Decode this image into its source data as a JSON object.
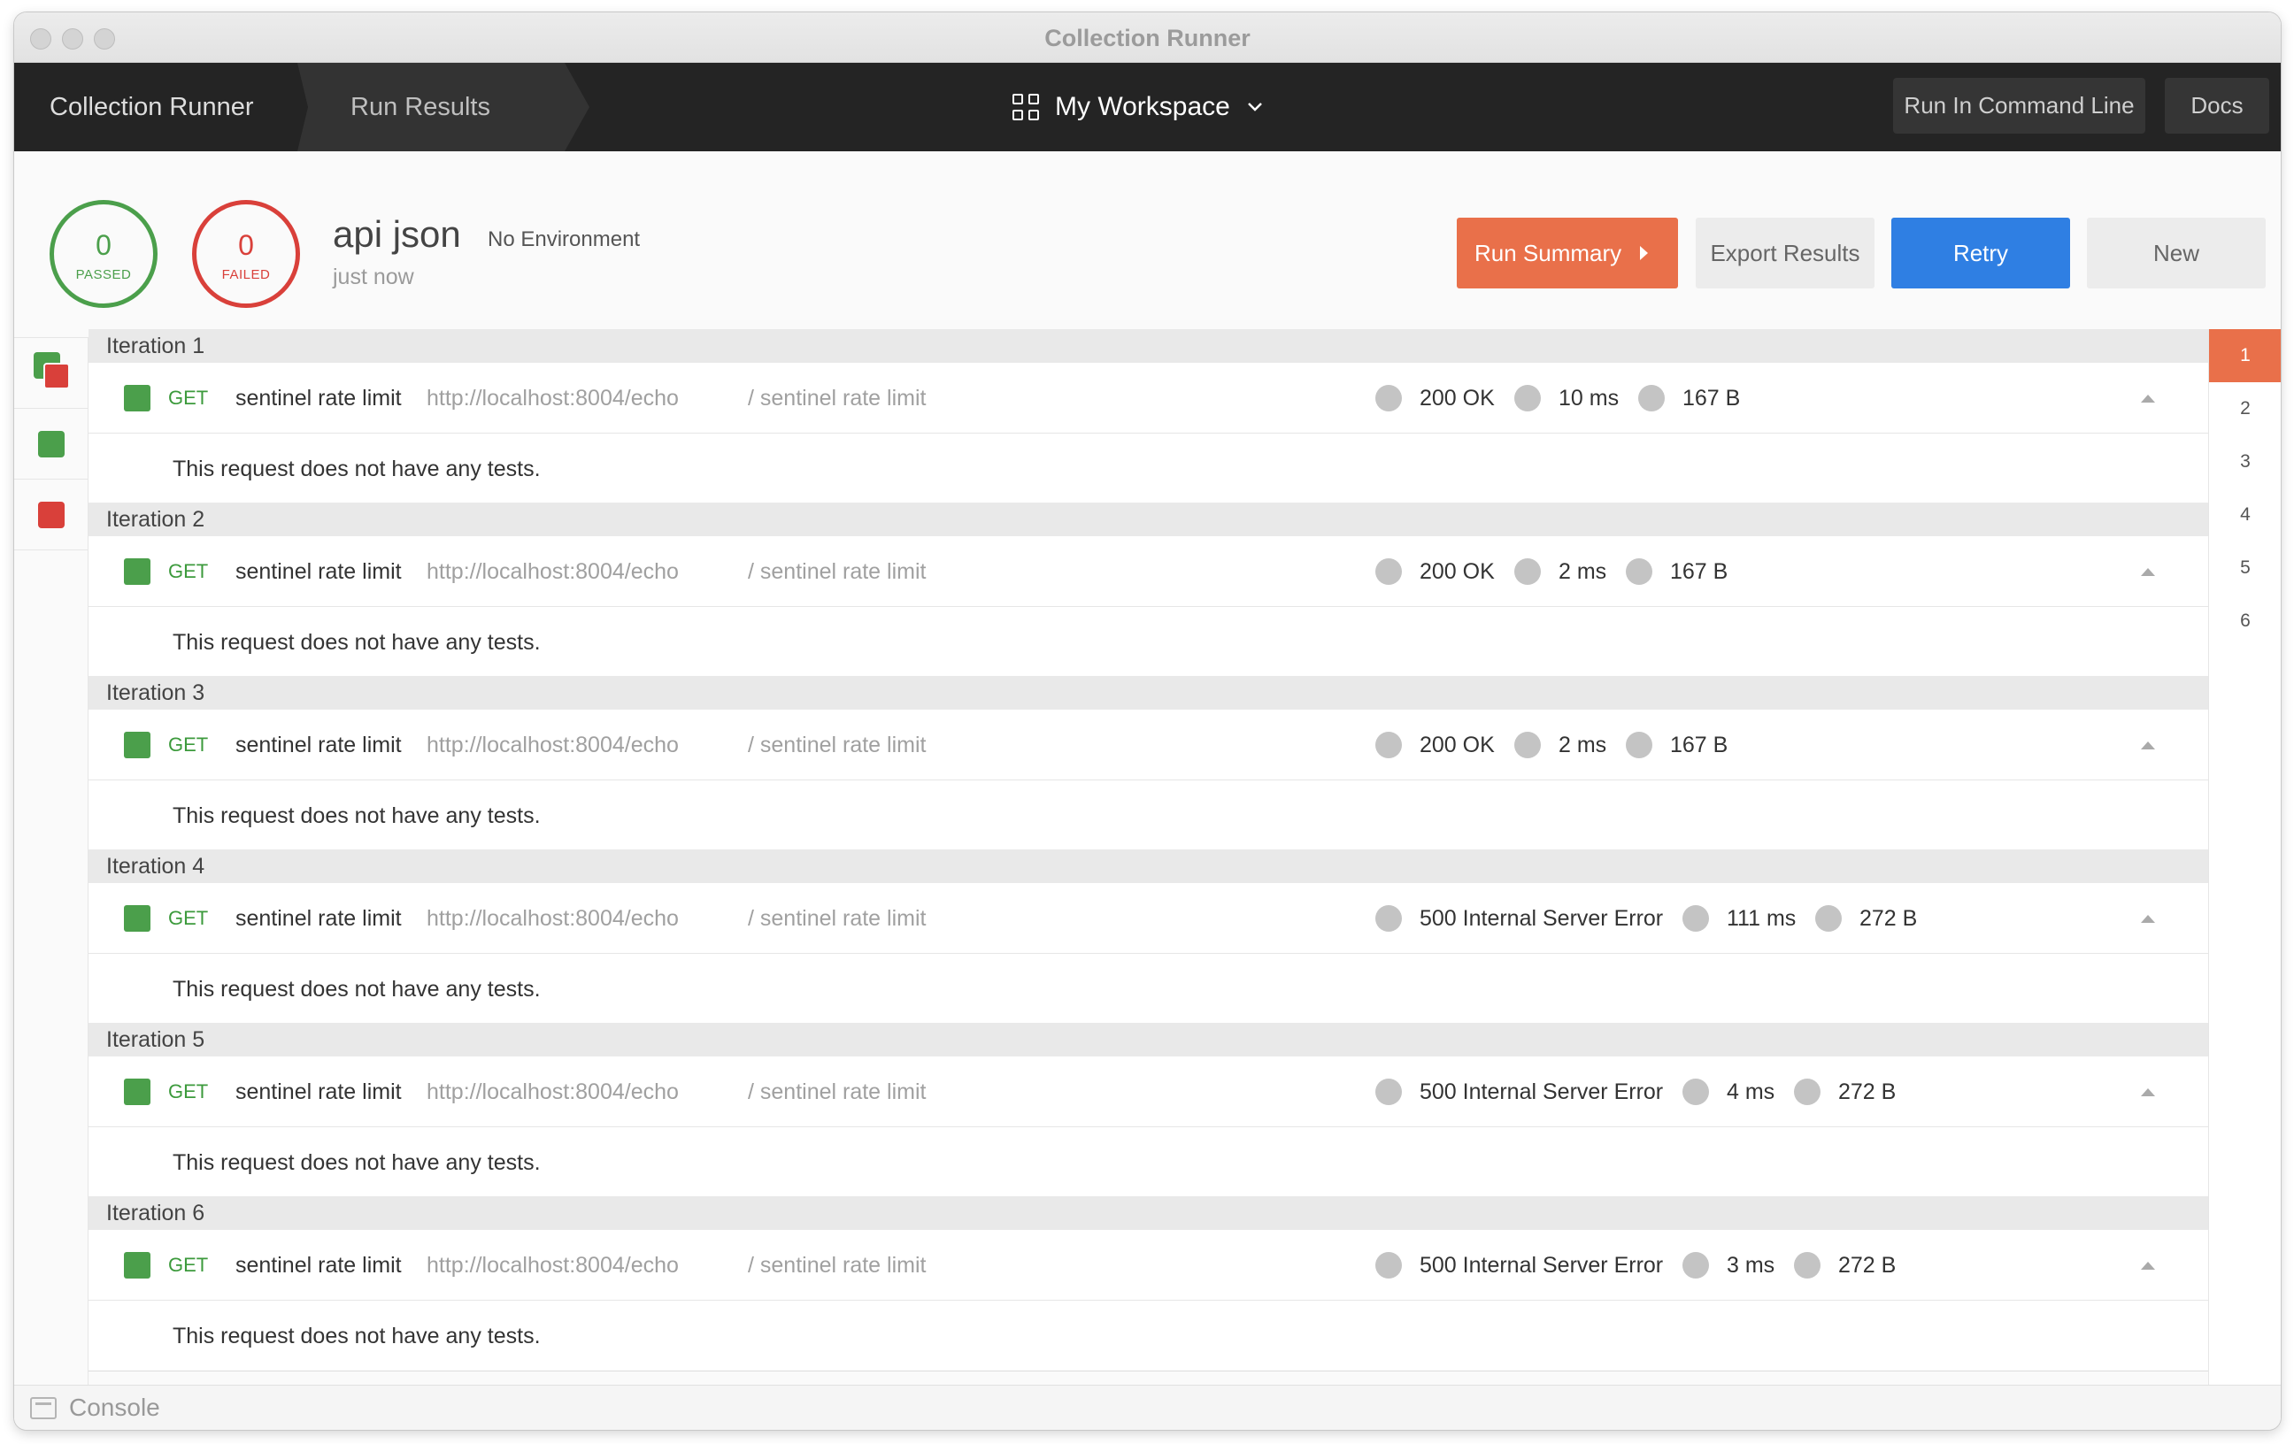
{
  "window": {
    "title": "Collection Runner"
  },
  "nav": {
    "tab_runner": "Collection Runner",
    "tab_results": "Run Results",
    "workspace": "My Workspace",
    "btn_cli": "Run In Command Line",
    "btn_docs": "Docs"
  },
  "summary": {
    "passed_count": "0",
    "passed_label": "PASSED",
    "failed_count": "0",
    "failed_label": "FAILED",
    "run_name": "api json",
    "environment": "No Environment",
    "timestamp": "just now",
    "btn_summary": "Run Summary",
    "btn_export": "Export Results",
    "btn_retry": "Retry",
    "btn_new": "New"
  },
  "colors": {
    "pass": "#4b9f4b",
    "fail": "#d9403a",
    "accent": "#e9704a",
    "primary": "#2f7fe3"
  },
  "iterations": [
    {
      "title": "Iteration 1",
      "method": "GET",
      "name": "sentinel rate limit",
      "url": "http://localhost:8004/echo",
      "path": "/ sentinel rate limit",
      "status": "200 OK",
      "time": "10 ms",
      "size": "167 B",
      "tests": "This request does not have any tests."
    },
    {
      "title": "Iteration 2",
      "method": "GET",
      "name": "sentinel rate limit",
      "url": "http://localhost:8004/echo",
      "path": "/ sentinel rate limit",
      "status": "200 OK",
      "time": "2 ms",
      "size": "167 B",
      "tests": "This request does not have any tests."
    },
    {
      "title": "Iteration 3",
      "method": "GET",
      "name": "sentinel rate limit",
      "url": "http://localhost:8004/echo",
      "path": "/ sentinel rate limit",
      "status": "200 OK",
      "time": "2 ms",
      "size": "167 B",
      "tests": "This request does not have any tests."
    },
    {
      "title": "Iteration 4",
      "method": "GET",
      "name": "sentinel rate limit",
      "url": "http://localhost:8004/echo",
      "path": "/ sentinel rate limit",
      "status": "500 Internal Server Error",
      "time": "111 ms",
      "size": "272 B",
      "tests": "This request does not have any tests."
    },
    {
      "title": "Iteration 5",
      "method": "GET",
      "name": "sentinel rate limit",
      "url": "http://localhost:8004/echo",
      "path": "/ sentinel rate limit",
      "status": "500 Internal Server Error",
      "time": "4 ms",
      "size": "272 B",
      "tests": "This request does not have any tests."
    },
    {
      "title": "Iteration 6",
      "method": "GET",
      "name": "sentinel rate limit",
      "url": "http://localhost:8004/echo",
      "path": "/ sentinel rate limit",
      "status": "500 Internal Server Error",
      "time": "3 ms",
      "size": "272 B",
      "tests": "This request does not have any tests."
    }
  ],
  "iteration_index": [
    "1",
    "2",
    "3",
    "4",
    "5",
    "6"
  ],
  "console": {
    "label": "Console"
  }
}
